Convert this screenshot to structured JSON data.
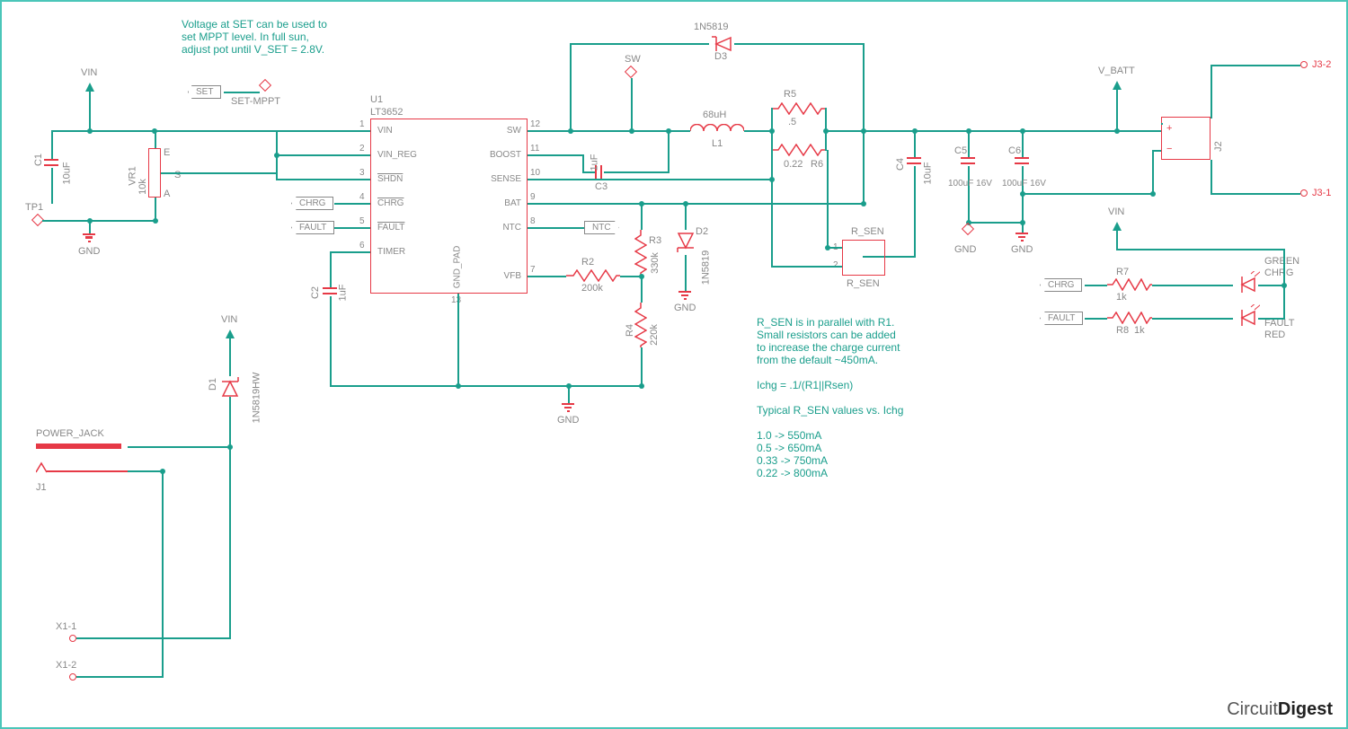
{
  "notes": {
    "mppt": "Voltage at SET can be used to\nset MPPT level. In full sun,\nadjust pot until V_SET = 2.8V.",
    "rsen": "R_SEN is in parallel with R1.\nSmall resistors can be added\nto increase the charge current\nfrom the default ~450mA.\n\nIchg = .1/(R1||Rsen)\n\nTypical R_SEN values vs. Ichg\n\n1.0   -> 550mA\n0.5   -> 650mA\n0.33 -> 750mA\n0.22 -> 800mA"
  },
  "ic": {
    "ref": "U1",
    "part": "LT3652",
    "pins_left": [
      "VIN",
      "VIN_REG",
      "SHDN",
      "CHRG",
      "FAULT",
      "TIMER"
    ],
    "pins_right": [
      "SW",
      "BOOST",
      "SENSE",
      "BAT",
      "NTC",
      "VFB"
    ],
    "pins_bottom": [
      "GND_PAD"
    ],
    "nums_left": [
      "1",
      "2",
      "3",
      "4",
      "5",
      "6"
    ],
    "nums_right": [
      "12",
      "11",
      "10",
      "9",
      "8",
      "7"
    ],
    "nums_bottom": [
      "13"
    ]
  },
  "nets": {
    "vin": "VIN",
    "gnd": "GND",
    "vbatt": "V_BATT",
    "sw": "SW",
    "set": "SET",
    "chrg": "CHRG",
    "fault": "FAULT",
    "ntc": "NTC",
    "setmppt": "SET-MPPT",
    "rsen": "R_SEN",
    "tp1": "TP1"
  },
  "parts": {
    "C1": {
      "ref": "C1",
      "val": "10uF"
    },
    "C2": {
      "ref": "C2",
      "val": "1uF"
    },
    "C3": {
      "ref": "C3",
      "val": "1uF"
    },
    "C4": {
      "ref": "C4",
      "val": "10uF"
    },
    "C5": {
      "ref": "C5",
      "val": "100uF 16V"
    },
    "C6": {
      "ref": "C6",
      "val": "100uF 16V"
    },
    "VR1": {
      "ref": "VR1",
      "val": "10k"
    },
    "R2": {
      "ref": "R2",
      "val": "200k"
    },
    "R3": {
      "ref": "R3",
      "val": "330k"
    },
    "R4": {
      "ref": "R4",
      "val": "220k"
    },
    "R5": {
      "ref": "R5",
      "val": ".5"
    },
    "R6": {
      "ref": "R6",
      "val": "0.22"
    },
    "R7": {
      "ref": "R7",
      "val": "1k"
    },
    "R8": {
      "ref": "R8",
      "val": "1k"
    },
    "L1": {
      "ref": "L1",
      "val": "68uH"
    },
    "D1": {
      "ref": "D1",
      "val": "1N5819HW"
    },
    "D2": {
      "ref": "D2",
      "val": "1N5819"
    },
    "D3": {
      "ref": "D3",
      "val": "1N5819"
    },
    "RSEN": {
      "ref": "R_SEN",
      "val": "R_SEN",
      "p1": "1",
      "p2": "2"
    },
    "J1": {
      "ref": "J1",
      "val": "POWER_JACK"
    },
    "J2": {
      "ref": "J2"
    },
    "J3_1": "J3-1",
    "J3_2": "J3-2",
    "X1_1": "X1-1",
    "X1_2": "X1-2",
    "LED_G": {
      "ref": "CHRG",
      "val": "GREEN"
    },
    "LED_R": {
      "ref": "FAULT",
      "val": "RED"
    }
  },
  "pot_pins": {
    "e": "E",
    "a": "A",
    "s": "S"
  },
  "watermark": {
    "a": "Circuit",
    "b": "Digest"
  }
}
